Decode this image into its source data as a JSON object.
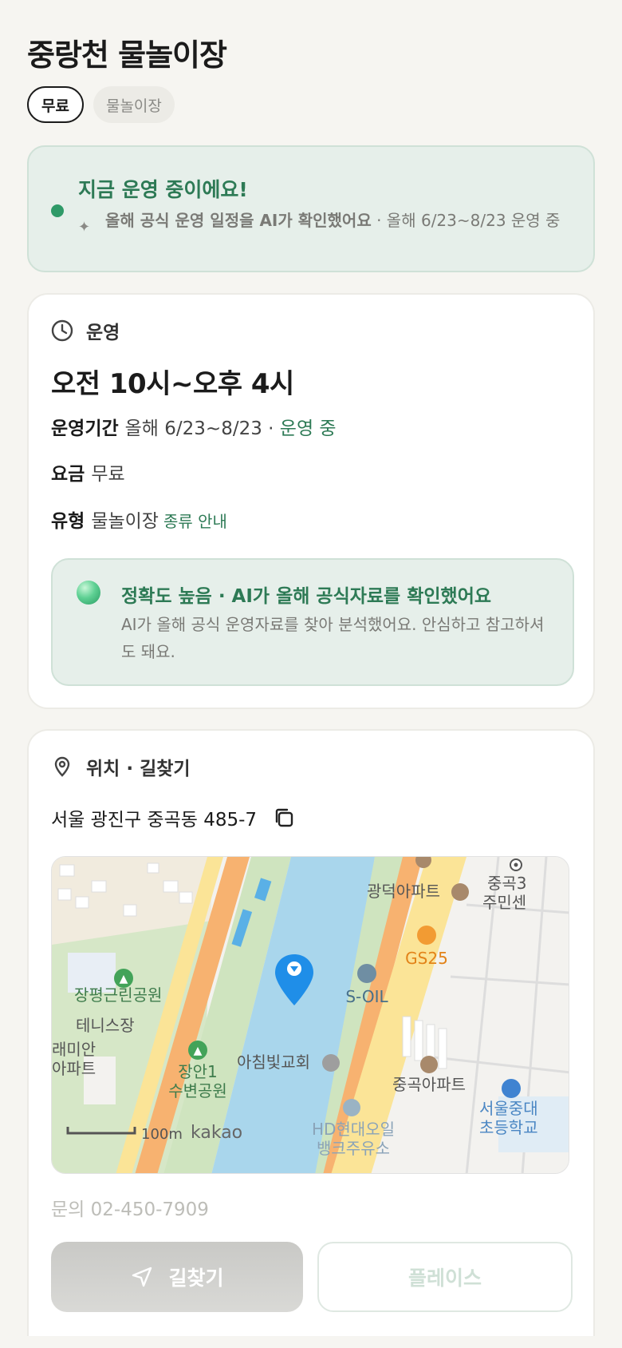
{
  "header": {
    "title": "중랑천 물놀이장",
    "tags": [
      "무료",
      "물놀이장"
    ]
  },
  "status": {
    "title": "지금 운영 중이에요!",
    "desc_bold": "올해 공식 운영 일정을 AI가 확인했어요",
    "desc_rest": " · 올해 6/23~8/23 운영 중"
  },
  "operation": {
    "section_label": "운영",
    "hours": "오전 10시~오후 4시",
    "period_key": "운영기간",
    "period_value": "올해 6/23~8/23 · ",
    "period_status": "운영 중",
    "fee_key": "요금",
    "fee_value": "무료",
    "type_key": "유형",
    "type_value": "물놀이장",
    "type_link": "종류 안내",
    "accuracy_title": "정확도 높음 · AI가 올해 공식자료를 확인했어요",
    "accuracy_desc": "AI가 올해 공식 운영자료를 찾아 분석했어요. 안심하고 참고하셔도 돼요."
  },
  "location": {
    "section_label": "위치 · 길찾기",
    "address": "서울 광진구 중곡동 485-7",
    "map_labels": {
      "apt1": "광덕아파트",
      "community": "중곡3",
      "community2": "주민센",
      "gs25": "GS25",
      "park1": "장평근린공원",
      "soil": "S-OIL",
      "tennis": "테니스장",
      "raemian1": "래미안",
      "raemian2": "아파트",
      "park2a": "장안1",
      "park2b": "수변공원",
      "church": "아침빛교회",
      "apt2": "중곡아파트",
      "school1": "서울중대",
      "school2": "초등학교",
      "hd1": "HD현대오일",
      "hd2": "뱅크주유소",
      "scale": "100m",
      "brand": "kakao"
    },
    "inquiry": "문의 02-450-7909",
    "directions_label": "길찾기",
    "place_label": "플레이스"
  },
  "colors": {
    "accent_green": "#2d7a55",
    "status_bg": "#e6efea",
    "water": "#a9d6ec",
    "road_orange": "#f7b270",
    "road_yellow": "#fbe497",
    "marker_blue": "#1f8ee8"
  },
  "icons": [
    "sparkle-icon",
    "clock-icon",
    "location-pin-icon",
    "copy-icon",
    "navigation-arrow-icon",
    "map-marker-icon"
  ]
}
